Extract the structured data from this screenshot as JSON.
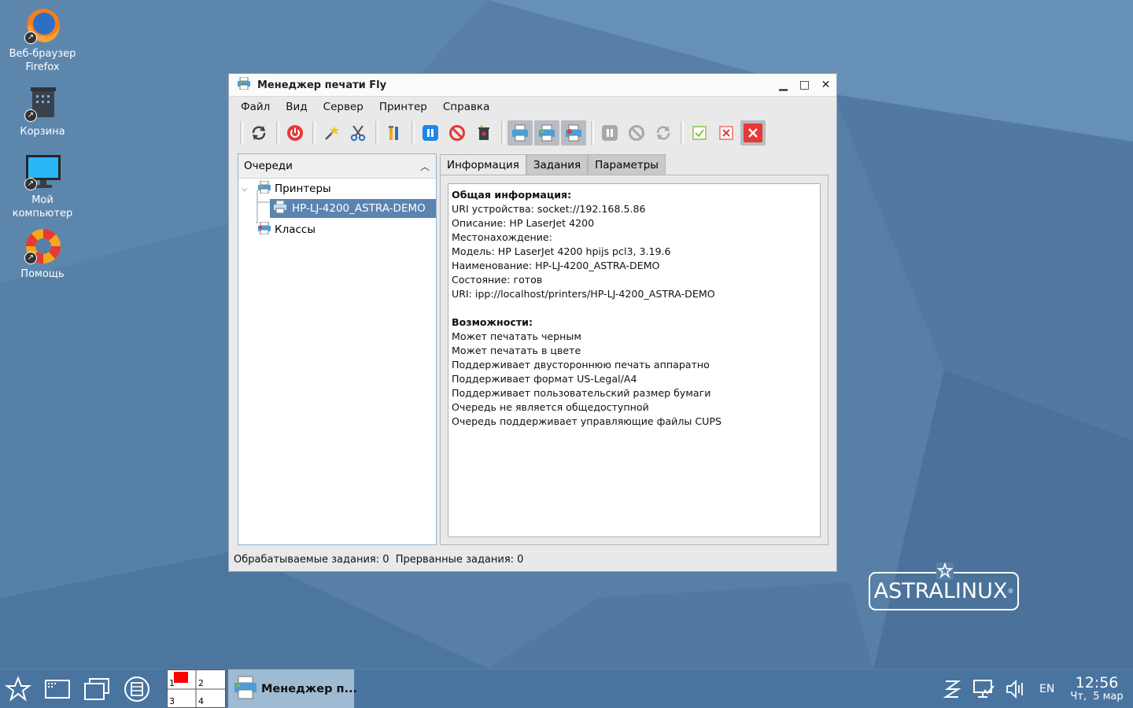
{
  "desktop": {
    "icons": [
      {
        "label_line1": "Веб-браузер",
        "label_line2": "Firefox",
        "icon": "firefox-icon"
      },
      {
        "label_line1": "Корзина",
        "label_line2": "",
        "icon": "trash-icon"
      },
      {
        "label_line1": "Мой",
        "label_line2": "компьютер",
        "icon": "computer-icon"
      },
      {
        "label_line1": "Помощь",
        "label_line2": "",
        "icon": "lifebuoy-icon"
      }
    ],
    "logo": "ASTRALINUX"
  },
  "window": {
    "title": "Менеджер печати Fly",
    "menu": [
      "Файл",
      "Вид",
      "Сервер",
      "Принтер",
      "Справка"
    ],
    "left_panel": {
      "header": "Очереди",
      "printers_label": "Принтеры",
      "printer_item": "HP-LJ-4200_ASTRA-DEMO",
      "classes_label": "Классы"
    },
    "tabs": [
      "Информация",
      "Задания",
      "Параметры"
    ],
    "info": {
      "general_heading": "Общая информация:",
      "general": [
        "URI устройства: socket://192.168.5.86",
        "Описание: HP LaserJet 4200",
        "Местонахождение:",
        "Модель: HP LaserJet 4200 hpijs pcl3, 3.19.6",
        "Наименование: HP-LJ-4200_ASTRA-DEMO",
        "Состояние: готов",
        "URI: ipp://localhost/printers/HP-LJ-4200_ASTRA-DEMO"
      ],
      "caps_heading": "Возможности:",
      "caps": [
        "Может печатать черным",
        "Может печатать в цвете",
        "Поддерживает двустороннюю печать аппаратно",
        "Поддерживает формат US-Legal/A4",
        "Поддерживает пользовательский размер бумаги",
        "Очередь не является общедоступной",
        "Очередь поддерживает управляющие файлы CUPS"
      ]
    },
    "status": "Обрабатываемые задания: 0  Прерванные задания: 0"
  },
  "taskbar": {
    "pager": [
      "1",
      "2",
      "3",
      "4"
    ],
    "task_label": "Менеджер п...",
    "lang": "EN",
    "time": "12:56",
    "date": "Чт,  5 мар"
  }
}
